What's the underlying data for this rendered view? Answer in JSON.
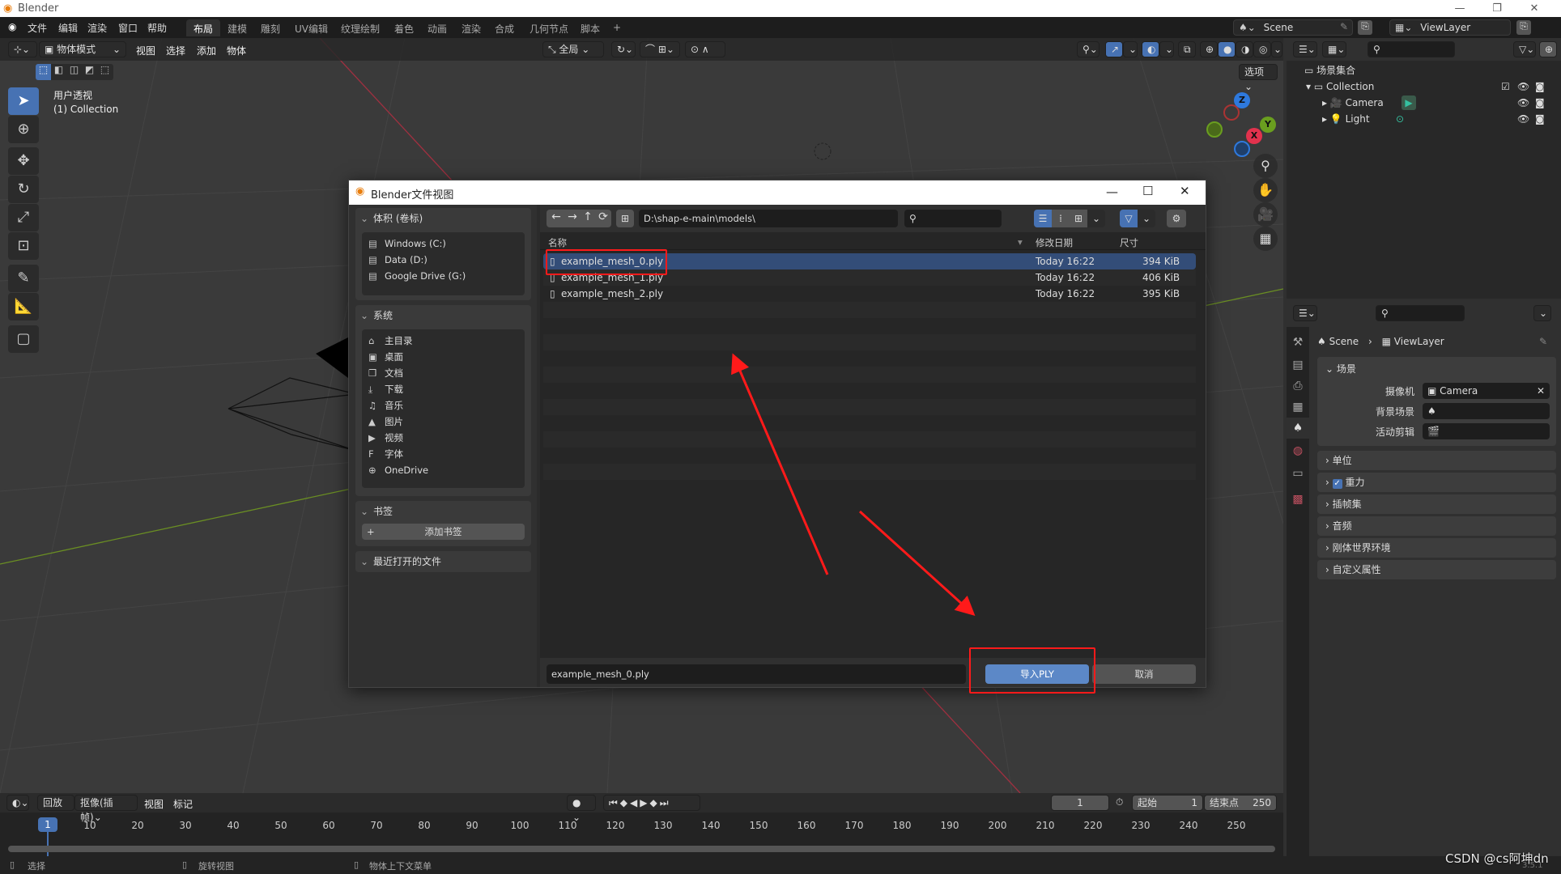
{
  "window": {
    "title": "Blender",
    "minimize": "—",
    "maximize": "❐",
    "close": "✕"
  },
  "menu": [
    "文件",
    "编辑",
    "渲染",
    "窗口",
    "帮助"
  ],
  "workspaces": [
    "布局",
    "建模",
    "雕刻",
    "UV编辑",
    "纹理绘制",
    "着色",
    "动画",
    "渲染",
    "合成",
    "几何节点",
    "脚本",
    "+"
  ],
  "active_workspace": "布局",
  "scene": {
    "name": "Scene",
    "view_layer": "ViewLayer"
  },
  "viewport": {
    "mode": "物体模式",
    "menus": [
      "视图",
      "选择",
      "添加",
      "物体"
    ],
    "transform_orientation": "全局",
    "options_label": "选项",
    "overlay_title": "用户透视",
    "overlay_collection": "(1) Collection",
    "axes": {
      "x": "X",
      "y": "Y",
      "z": "Z"
    }
  },
  "outliner": {
    "root": "场景集合",
    "items": [
      {
        "name": "Collection",
        "type": "collection"
      },
      {
        "name": "Camera",
        "type": "camera"
      },
      {
        "name": "Light",
        "type": "light"
      }
    ]
  },
  "properties": {
    "breadcrumb": [
      "Scene",
      "ViewLayer"
    ],
    "section": "场景",
    "fields": [
      {
        "label": "摄像机",
        "value": "Camera"
      },
      {
        "label": "背景场景",
        "value": ""
      },
      {
        "label": "活动剪辑",
        "value": ""
      }
    ],
    "panels": [
      {
        "label": "单位",
        "checkbox": false
      },
      {
        "label": "重力",
        "checkbox": true
      },
      {
        "label": "插帧集",
        "checkbox": false
      },
      {
        "label": "音频",
        "checkbox": false
      },
      {
        "label": "刚体世界环境",
        "checkbox": false
      },
      {
        "label": "自定义属性",
        "checkbox": false
      }
    ]
  },
  "dialog": {
    "title": "Blender文件视图",
    "path": "D:\\shap-e-main\\models\\",
    "search_placeholder": "",
    "columns": {
      "name": "名称",
      "date": "修改日期",
      "size": "尺寸"
    },
    "files": [
      {
        "name": "example_mesh_0.ply",
        "date": "Today 16:22",
        "size": "394 KiB",
        "selected": true
      },
      {
        "name": "example_mesh_1.ply",
        "date": "Today 16:22",
        "size": "406 KiB",
        "selected": false
      },
      {
        "name": "example_mesh_2.ply",
        "date": "Today 16:22",
        "size": "395 KiB",
        "selected": false
      }
    ],
    "filename": "example_mesh_0.ply",
    "import_button": "导入PLY",
    "cancel_button": "取消",
    "sidebar": {
      "volumes_title": "体积 (卷标)",
      "volumes": [
        "Windows (C:)",
        "Data (D:)",
        "Google Drive (G:)"
      ],
      "system_title": "系统",
      "system": [
        {
          "label": "主目录",
          "icon": "⌂"
        },
        {
          "label": "桌面",
          "icon": "▣"
        },
        {
          "label": "文档",
          "icon": "❐"
        },
        {
          "label": "下载",
          "icon": "⤓"
        },
        {
          "label": "音乐",
          "icon": "♫"
        },
        {
          "label": "图片",
          "icon": "▲"
        },
        {
          "label": "视频",
          "icon": "▶"
        },
        {
          "label": "字体",
          "icon": "F"
        },
        {
          "label": "OneDrive",
          "icon": "⊕"
        }
      ],
      "bookmarks_title": "书签",
      "add_bookmark": "添加书签",
      "recent_title": "最近打开的文件"
    }
  },
  "timeline": {
    "menus": [
      "回放",
      "抠像(插帧)",
      "视图",
      "标记"
    ],
    "current_frame": "1",
    "start_label": "起始",
    "start": "1",
    "end_label": "结束点",
    "end": "250",
    "ticks": [
      "10",
      "20",
      "30",
      "40",
      "50",
      "60",
      "70",
      "80",
      "90",
      "100",
      "110",
      "120",
      "130",
      "140",
      "150",
      "160",
      "170",
      "180",
      "190",
      "200",
      "210",
      "220",
      "230",
      "240",
      "250"
    ]
  },
  "statusbar": {
    "select": "选择",
    "rotate": "旋转视图",
    "context": "物体上下文菜单",
    "version": "3.5.1"
  },
  "watermark": "CSDN @cs阿坤dn"
}
